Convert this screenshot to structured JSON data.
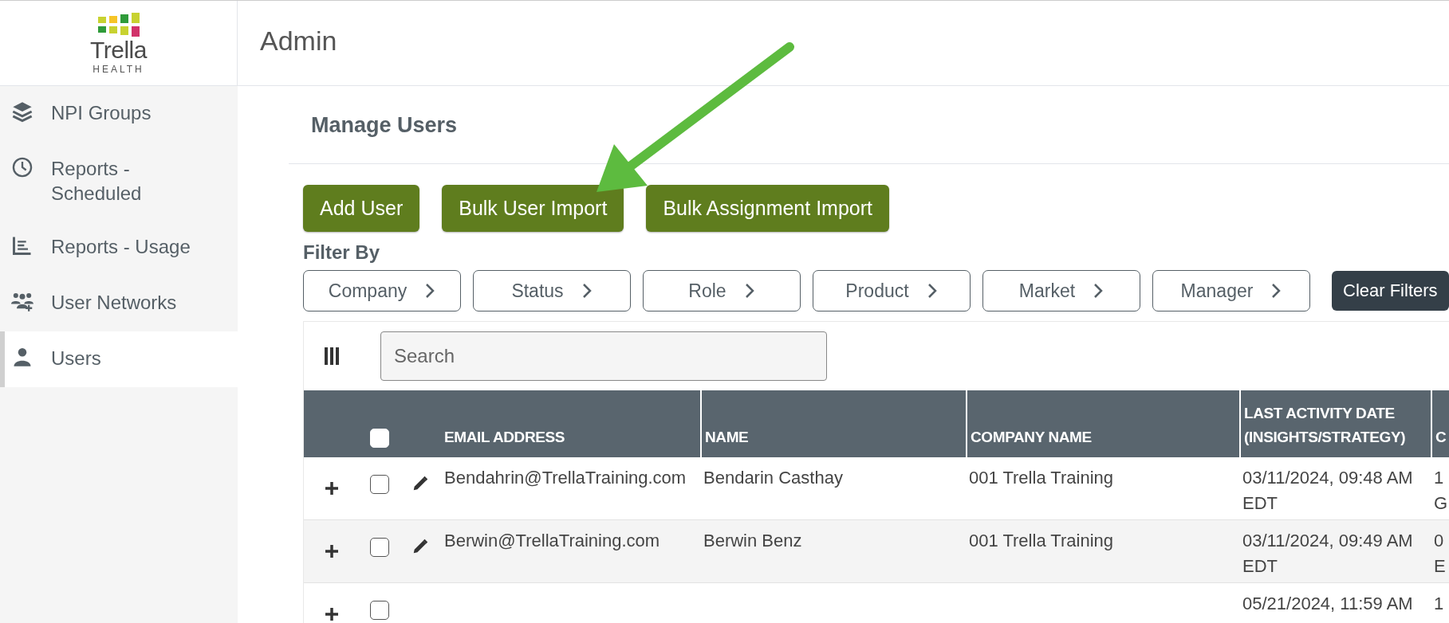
{
  "header": {
    "logo": {
      "name": "Trella",
      "tagline": "HEALTH"
    },
    "title": "Admin"
  },
  "sidebar": {
    "items": [
      {
        "label": "NPI Groups",
        "kind": "layers",
        "selected": false
      },
      {
        "label": "Reports - Scheduled",
        "kind": "clock",
        "selected": false
      },
      {
        "label": "Reports - Usage",
        "kind": "chart",
        "selected": false
      },
      {
        "label": "User Networks",
        "kind": "users",
        "selected": false
      },
      {
        "label": "Users",
        "kind": "user",
        "selected": true
      }
    ]
  },
  "page": {
    "title": "Manage Users",
    "actions": [
      "Add User",
      "Bulk User Import",
      "Bulk Assignment Import"
    ],
    "filter_label": "Filter By",
    "filters": [
      "Company",
      "Status",
      "Role",
      "Product",
      "Market",
      "Manager"
    ],
    "clear_button": "Clear Filters"
  },
  "table": {
    "search": {
      "placeholder": "Search"
    },
    "header_checkbox": {
      "checked": false
    },
    "columns": [
      "EMAIL ADDRESS",
      "NAME",
      "COMPANY NAME",
      "LAST ACTIVITY DATE (INSIGHTS/STRATEGY)",
      "C"
    ],
    "rows": [
      {
        "checked": false,
        "email": "Bendahrin@TrellaTraining.com",
        "name": "Bendarin Casthay",
        "company": "001 Trella Training",
        "last_activity": [
          "03/11/2024, 09:48 AM",
          "EDT"
        ],
        "column_5": [
          "1",
          "G"
        ]
      },
      {
        "checked": false,
        "email": "Berwin@TrellaTraining.com",
        "name": "Berwin Benz",
        "company": "001 Trella Training",
        "last_activity": [
          "03/11/2024, 09:49 AM",
          "EDT"
        ],
        "column_5": [
          "0",
          "E"
        ]
      },
      {
        "checked": false,
        "last_activity": [
          "05/21/2024, 11:59 AM"
        ],
        "column_5": [
          "1"
        ]
      }
    ]
  }
}
